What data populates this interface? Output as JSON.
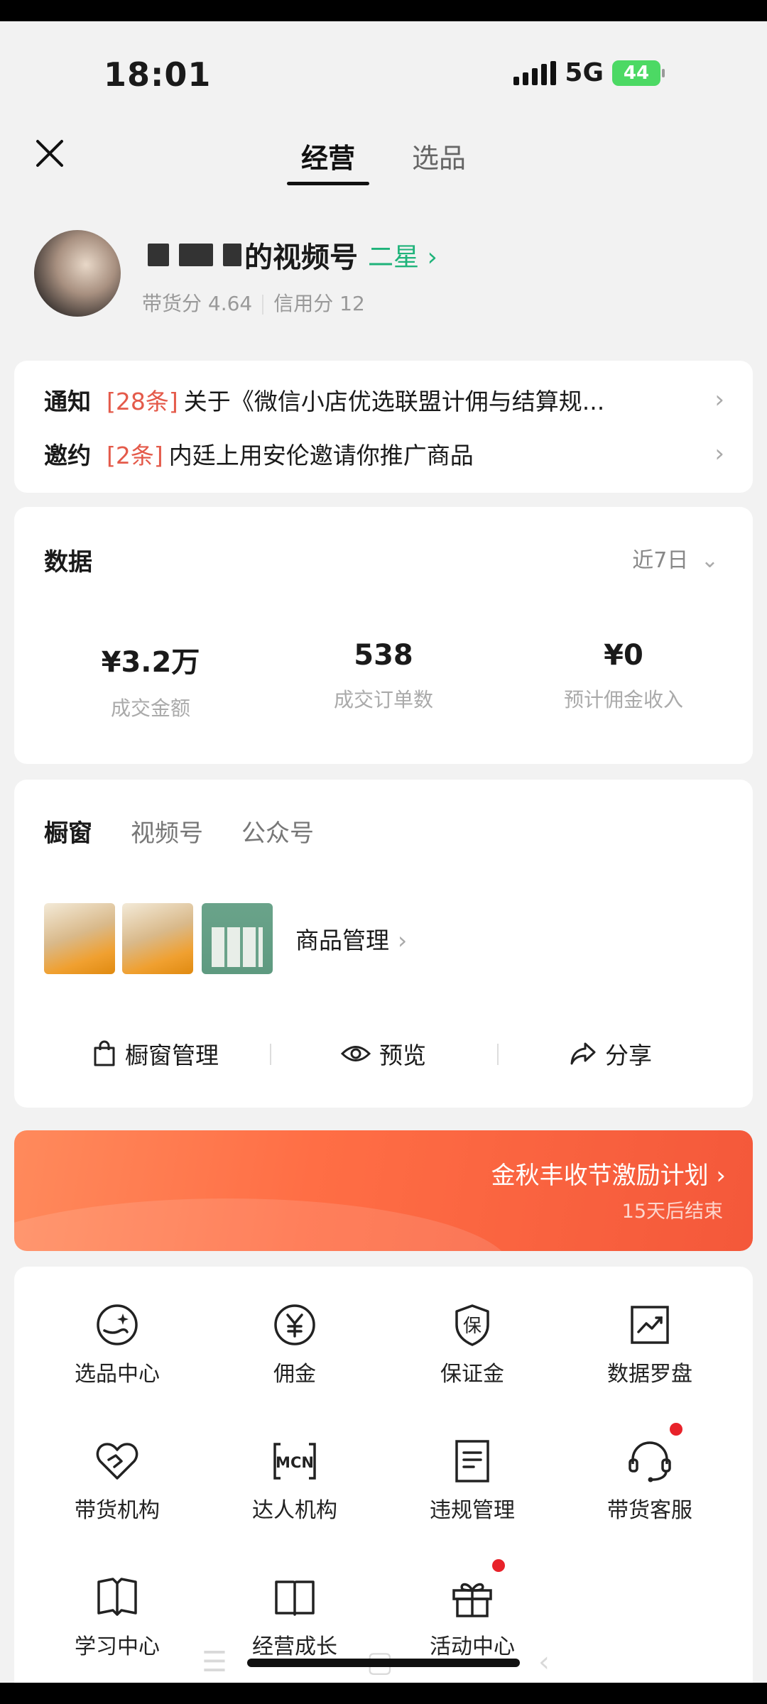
{
  "status_bar": {
    "time": "18:01",
    "network": "5G",
    "battery": "44"
  },
  "header": {
    "tabs": [
      "经营",
      "选品"
    ]
  },
  "profile": {
    "name_suffix": "的视频号",
    "level": "二星",
    "stats": {
      "goods_score": "带货分 4.64",
      "credit_score": "信用分 12"
    }
  },
  "notices": [
    {
      "label": "通知",
      "count": "[28条]",
      "text": "关于《微信小店优选联盟计佣与结算规..."
    },
    {
      "label": "邀约",
      "count": "[2条]",
      "text": "内廷上用安伦邀请你推广商品"
    }
  ],
  "data": {
    "title": "数据",
    "period": "近7日",
    "metrics": [
      {
        "value": "¥3.2万",
        "label": "成交金额"
      },
      {
        "value": "538",
        "label": "成交订单数"
      },
      {
        "value": "¥0",
        "label": "预计佣金收入"
      }
    ]
  },
  "window": {
    "tabs": [
      "橱窗",
      "视频号",
      "公众号"
    ],
    "goods_mgmt": "商品管理",
    "actions": [
      "橱窗管理",
      "预览",
      "分享"
    ]
  },
  "banner": {
    "title": "金秋丰收节激励计划",
    "subtitle": "15天后结束"
  },
  "grid": [
    {
      "label": "选品中心",
      "icon": "product-selection-icon"
    },
    {
      "label": "佣金",
      "icon": "yen-coin-icon"
    },
    {
      "label": "保证金",
      "icon": "deposit-shield-icon"
    },
    {
      "label": "数据罗盘",
      "icon": "data-chart-icon"
    },
    {
      "label": "带货机构",
      "icon": "handshake-heart-icon"
    },
    {
      "label": "达人机构",
      "icon": "mcn-icon",
      "icon_text": "MCN"
    },
    {
      "label": "违规管理",
      "icon": "document-icon"
    },
    {
      "label": "带货客服",
      "icon": "headset-icon"
    },
    {
      "label": "学习中心",
      "icon": "open-book-icon"
    },
    {
      "label": "经营成长",
      "icon": "book-icon"
    },
    {
      "label": "活动中心",
      "icon": "gift-icon"
    }
  ],
  "icon_glyphs": {
    "deposit": "保"
  },
  "colors": {
    "accent_green": "#1fb37a",
    "notice_red": "#e45a4a",
    "banner_orange": "#ff6e45",
    "badge_red": "#e8222a"
  }
}
